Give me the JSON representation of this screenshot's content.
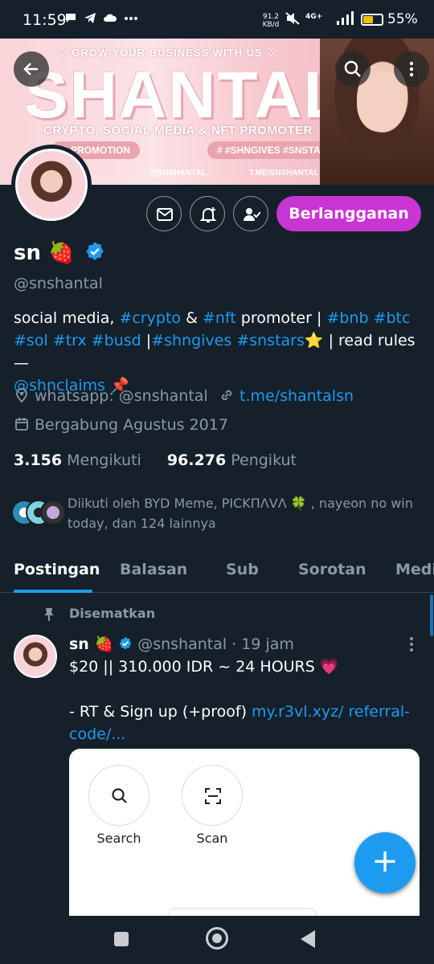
{
  "status_bar": {
    "time": "11:59",
    "net_speed": "91.2",
    "net_unit": "KB/d",
    "network": "4G+",
    "battery": "55%",
    "battery_level": 0.55,
    "left_icons": [
      "chat-icon",
      "telegram-icon",
      "cloud-icon",
      "more-dots-icon"
    ],
    "right_icons": [
      "mute-icon",
      "signal-icon",
      "battery-icon"
    ]
  },
  "banner": {
    "tagline": "♡ GROW YOUR BUSINESS WITH US ♡",
    "brand": "SHANTAL",
    "subtitle": "CRYPTO, SOCIAL MEDIA & NFT PROMOTER",
    "pill_left": "R PROMOTION",
    "pill_right": "# #SHNGIVES #SNSTARS",
    "social_x": "@SNSHANTAL",
    "social_tg": "T.ME/SNSHANTAL",
    "accent": "#f7c9cf"
  },
  "header": {
    "back_icon": "arrow-left-icon",
    "search_icon": "search-icon",
    "more_icon": "more-vertical-icon"
  },
  "actions": {
    "subscribe_label": "Berlangganan",
    "subscribe_color": "#c935d3"
  },
  "profile": {
    "name": "sn 🍓",
    "handle": "@snshantal",
    "bio_1": "social media, ",
    "bio_tag_crypto": "#crypto",
    "bio_2": " & ",
    "bio_tag_nft": "#nft",
    "bio_3": " promoter | ",
    "bio_tag_bnb": "#bnb",
    "bio_4": " ",
    "bio_tag_btc": "#btc",
    "bio_tag_sol": "#sol",
    "bio_tag_trx": "#trx",
    "bio_tag_busd": "#busd",
    "bio_5": " |",
    "bio_tag_shngives": "#shngives",
    "bio_tag_snstars": "#snstars",
    "bio_6": "⭐ | read rules —",
    "bio_mention": "@shnclaims",
    "bio_7": " 📌",
    "location": "whatsapp: @snshantal",
    "website": "t.me/shantalsn",
    "joined": "Bergabung Agustus 2017",
    "following_count": "3.156",
    "following_label": "Mengikuti",
    "followers_count": "96.276",
    "followers_label": "Pengikut",
    "followed_by": "Diikuti oleh BYD Meme, PICKПΛVΛ 🍀 , nayeon no win today, dan 124 lainnya"
  },
  "tabs": [
    "Postingan",
    "Balasan",
    "Sub",
    "Sorotan",
    "Medi"
  ],
  "post": {
    "pinned_label": "Disematkan",
    "author": "sn 🍓",
    "handle_time": "@snshantal · 19 jam",
    "line1": "$20 || 310.000 IDR ~ 24 HOURS 💗",
    "line2": "- RT & Sign up (+proof) ",
    "link": "my.r3vl.xyz/ referral-code/..."
  },
  "sheet": {
    "search_label": "Search",
    "scan_label": "Scan"
  },
  "fab_label": "+"
}
